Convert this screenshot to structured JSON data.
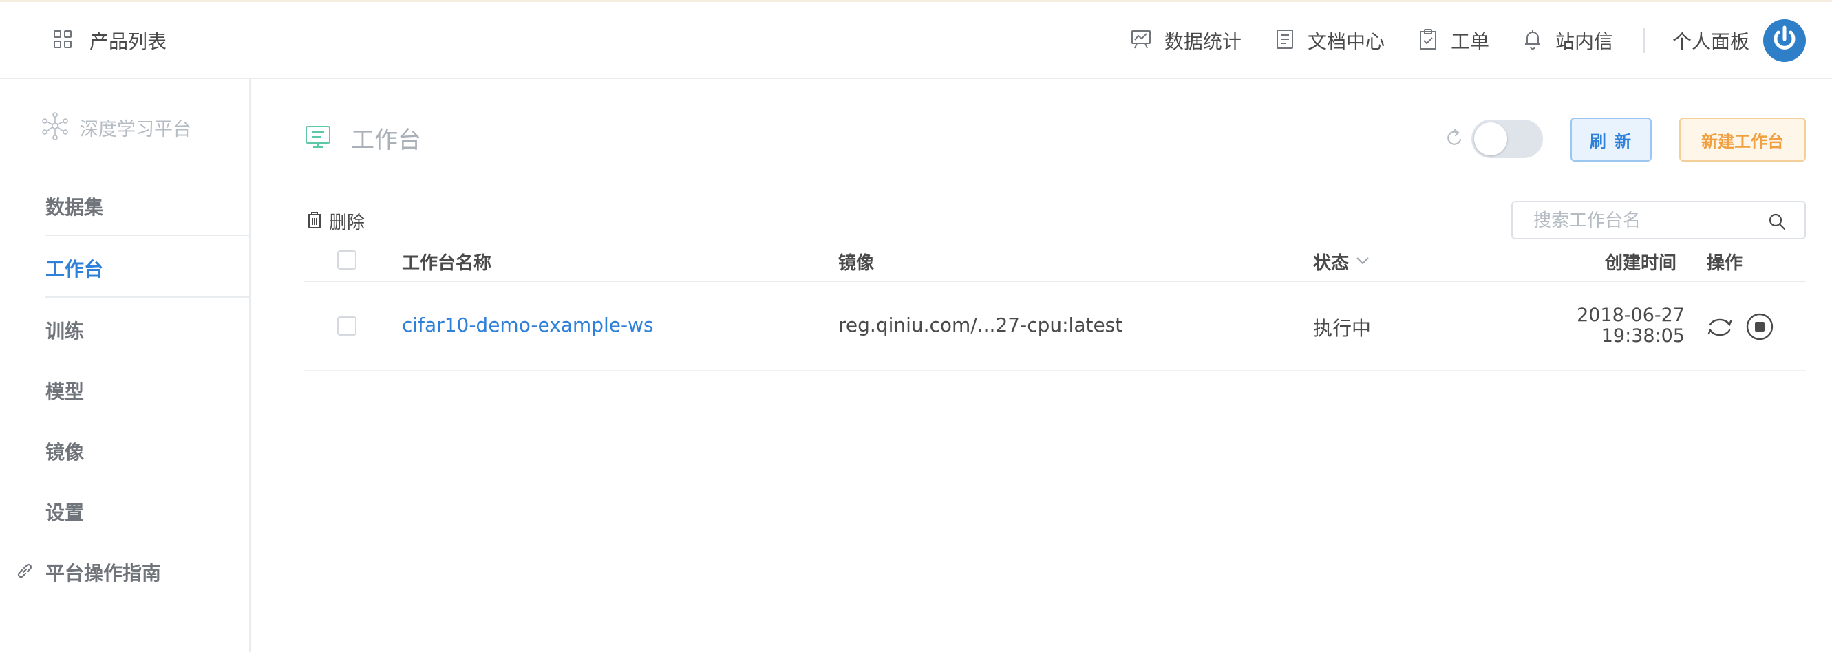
{
  "topbar": {
    "products_label": "产品列表",
    "nav": [
      {
        "label": "数据统计",
        "icon": "chart-icon"
      },
      {
        "label": "文档中心",
        "icon": "document-icon"
      },
      {
        "label": "工单",
        "icon": "clipboard-icon"
      },
      {
        "label": "站内信",
        "icon": "bell-icon"
      }
    ],
    "user_label": "个人面板"
  },
  "sidebar": {
    "brand": "深度学习平台",
    "items": [
      {
        "label": "数据集"
      },
      {
        "label": "工作台",
        "active": true
      },
      {
        "label": "训练"
      },
      {
        "label": "模型"
      },
      {
        "label": "镜像"
      },
      {
        "label": "设置"
      }
    ],
    "guide": "平台操作指南"
  },
  "page": {
    "title": "工作台",
    "refresh_label": "刷 新",
    "new_label": "新建工作台",
    "auto_refresh_on": false
  },
  "toolbar": {
    "delete_label": "删除",
    "search_placeholder": "搜索工作台名"
  },
  "table": {
    "columns": [
      "工作台名称",
      "镜像",
      "状态",
      "创建时间",
      "操作"
    ],
    "rows": [
      {
        "name": "cifar10-demo-example-ws",
        "image": "reg.qiniu.com/...27-cpu:latest",
        "status": "执行中",
        "date": "2018-06-27",
        "time": "19:38:05"
      }
    ]
  },
  "colors": {
    "accent": "#2f80d8",
    "warning": "#f0a040",
    "text": "#4a4a4a",
    "muted": "#70757c"
  }
}
